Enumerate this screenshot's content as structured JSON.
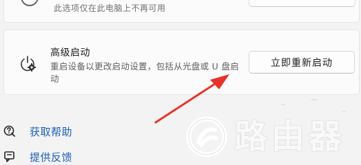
{
  "top_card": {
    "description": "此选项仅在此电脑上不再可用"
  },
  "advanced_startup": {
    "title": "高级启动",
    "description": "重启设备以更改启动设置，包括从光盘或 U 盘启动",
    "button_label": "立即重新启动"
  },
  "links": {
    "help_label": "获取帮助",
    "feedback_label": "提供反馈"
  },
  "watermark": {
    "text": "路由器"
  },
  "annotation": {
    "arrow_color": "#e8332a"
  },
  "colors": {
    "link": "#1a5fb4",
    "background": "#f3f3f3",
    "card": "#fbfbfb"
  }
}
